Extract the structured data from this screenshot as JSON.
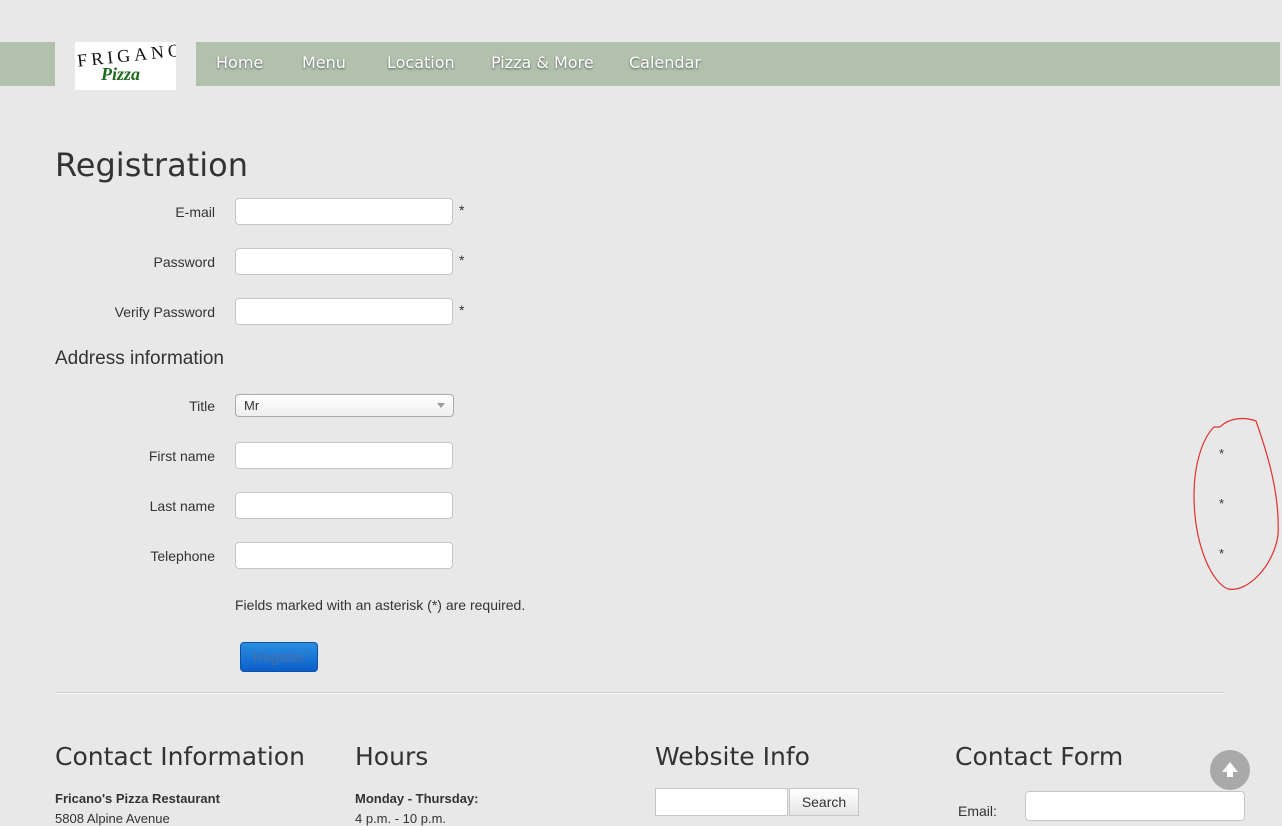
{
  "logo": {
    "line1": "FRIGANO'S",
    "line2": "Pizza"
  },
  "nav": {
    "items": [
      "Home",
      "Menu",
      "Location",
      "Pizza & More",
      "Calendar"
    ]
  },
  "page": {
    "title": "Registration"
  },
  "form": {
    "email_label": "E-mail",
    "password_label": "Password",
    "verify_label": "Verify Password",
    "asterisk": "*",
    "address_section": "Address information",
    "title_label": "Title",
    "title_value": "Mr",
    "first_name_label": "First name",
    "last_name_label": "Last name",
    "telephone_label": "Telephone",
    "required_note": "Fields marked with an asterisk (*) are required.",
    "register_label": "Register"
  },
  "footer": {
    "contact": {
      "heading": "Contact Information",
      "name": "Fricano's Pizza Restaurant",
      "address": "5808 Alpine Avenue"
    },
    "hours": {
      "heading": "Hours",
      "days": "Monday - Thursday:",
      "time": "4 p.m. - 10 p.m."
    },
    "website": {
      "heading": "Website Info",
      "search_label": "Search"
    },
    "contact_form": {
      "heading": "Contact Form",
      "email_label": "Email:"
    }
  },
  "annotation": {
    "color": "#e03030"
  },
  "colors": {
    "navbar": "#b1c1ae",
    "register_button": "#0c5fc8"
  }
}
